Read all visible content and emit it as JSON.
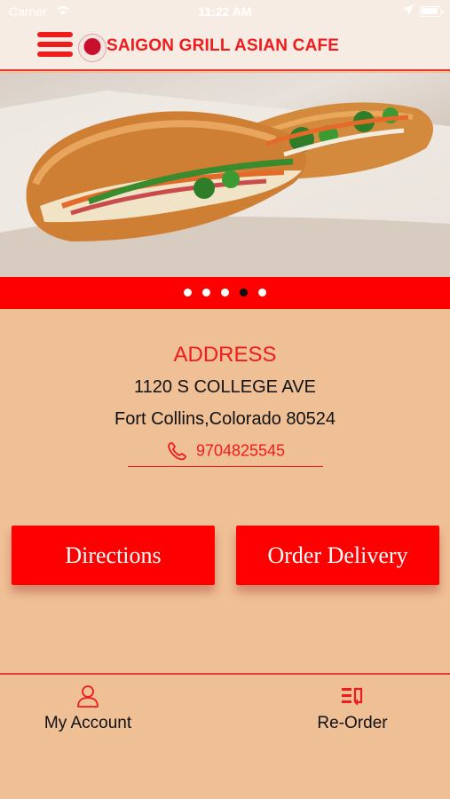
{
  "status_bar": {
    "carrier": "Carrier",
    "time": "11:22 AM"
  },
  "header": {
    "title": "SAIGON GRILL ASIAN CAFE"
  },
  "carousel": {
    "slides": 5,
    "active_index": 3
  },
  "address": {
    "title": "ADDRESS",
    "street": "1120 S COLLEGE AVE",
    "city_line": "Fort Collins,Colorado 80524",
    "phone": "9704825545"
  },
  "actions": {
    "directions_label": "Directions",
    "order_delivery_label": "Order Delivery"
  },
  "nav": {
    "account_label": "My Account",
    "reorder_label": "Re-Order"
  },
  "colors": {
    "accent": "#ee1c1c",
    "bar_red": "#ff0000",
    "background": "#efbf96"
  }
}
